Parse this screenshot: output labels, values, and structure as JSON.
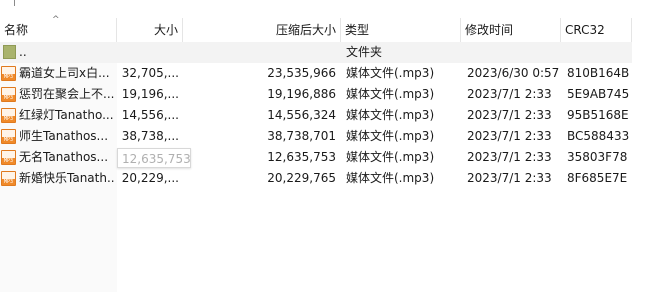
{
  "columns": {
    "name": "名称",
    "size": "大小",
    "packed": "压缩后大小",
    "type": "类型",
    "modified": "修改时间",
    "crc": "CRC32"
  },
  "parent_row": {
    "name": "..",
    "type": "文件夹"
  },
  "files": [
    {
      "name": "霸道女上司x白...",
      "size": "32,705,...",
      "packed": "23,535,966",
      "type": "媒体文件(.mp3)",
      "modified": "2023/6/30 0:57",
      "crc": "810B164B",
      "icon": "mp3-file-icon"
    },
    {
      "name": "惩罚在聚会上不...",
      "size": "19,196,...",
      "packed": "19,196,886",
      "type": "媒体文件(.mp3)",
      "modified": "2023/7/1 2:33",
      "crc": "5E9AB745",
      "icon": "mp3-file-icon"
    },
    {
      "name": "红绿灯Tanatho...",
      "size": "14,556,...",
      "packed": "14,556,324",
      "type": "媒体文件(.mp3)",
      "modified": "2023/7/1 2:33",
      "crc": "95B5168E",
      "icon": "mp3-file-icon"
    },
    {
      "name": "师生Tanathos...",
      "size": "38,738,...",
      "packed": "38,738,701",
      "type": "媒体文件(.mp3)",
      "modified": "2023/7/1 2:33",
      "crc": "BC588433",
      "icon": "mp3-file-icon"
    },
    {
      "name": "无名Tanathos...",
      "size": "12,635,...",
      "packed": "12,635,753",
      "type": "媒体文件(.mp3)",
      "modified": "2023/7/1 2:33",
      "crc": "35803F78",
      "icon": "mp3-file-icon"
    },
    {
      "name": "新婚快乐Tanath...",
      "size": "20,229,...",
      "packed": "20,229,765",
      "type": "媒体文件(.mp3)",
      "modified": "2023/7/1 2:33",
      "crc": "8F685E7E",
      "icon": "mp3-file-icon"
    }
  ],
  "tooltip": {
    "text": "12,635,753"
  },
  "icon_badge": "MP3"
}
